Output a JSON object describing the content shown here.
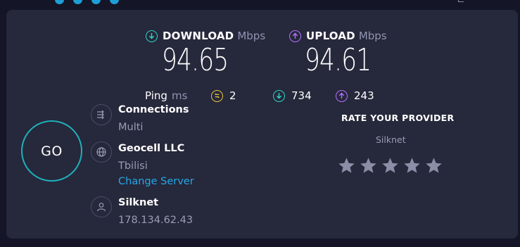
{
  "colors": {
    "download_accent": "#2fd3c5",
    "upload_accent": "#b26fff",
    "ping_accent": "#e8c53a",
    "go_ring": "#1fb1bb",
    "link": "#25a8e8",
    "panel": "#26283b",
    "background": "#141526"
  },
  "download": {
    "label": "DOWNLOAD",
    "unit": "Mbps",
    "value": "94.65",
    "icon": "download-arrow-icon"
  },
  "upload": {
    "label": "UPLOAD",
    "unit": "Mbps",
    "value": "94.61",
    "icon": "upload-arrow-icon"
  },
  "ping": {
    "label": "Ping",
    "unit": "ms",
    "idle": "2",
    "download": "734",
    "upload": "243"
  },
  "go": {
    "label": "GO"
  },
  "connections": {
    "title": "Connections",
    "value": "Multi",
    "icon": "connections-icon"
  },
  "server": {
    "title": "Geocell LLC",
    "location": "Tbilisi",
    "change_label": "Change Server",
    "icon": "globe-icon"
  },
  "provider": {
    "title": "Silknet",
    "ip": "178.134.62.43",
    "icon": "user-icon"
  },
  "rating": {
    "title": "RATE YOUR PROVIDER",
    "provider": "Silknet",
    "stars": 5,
    "selected": 0
  }
}
